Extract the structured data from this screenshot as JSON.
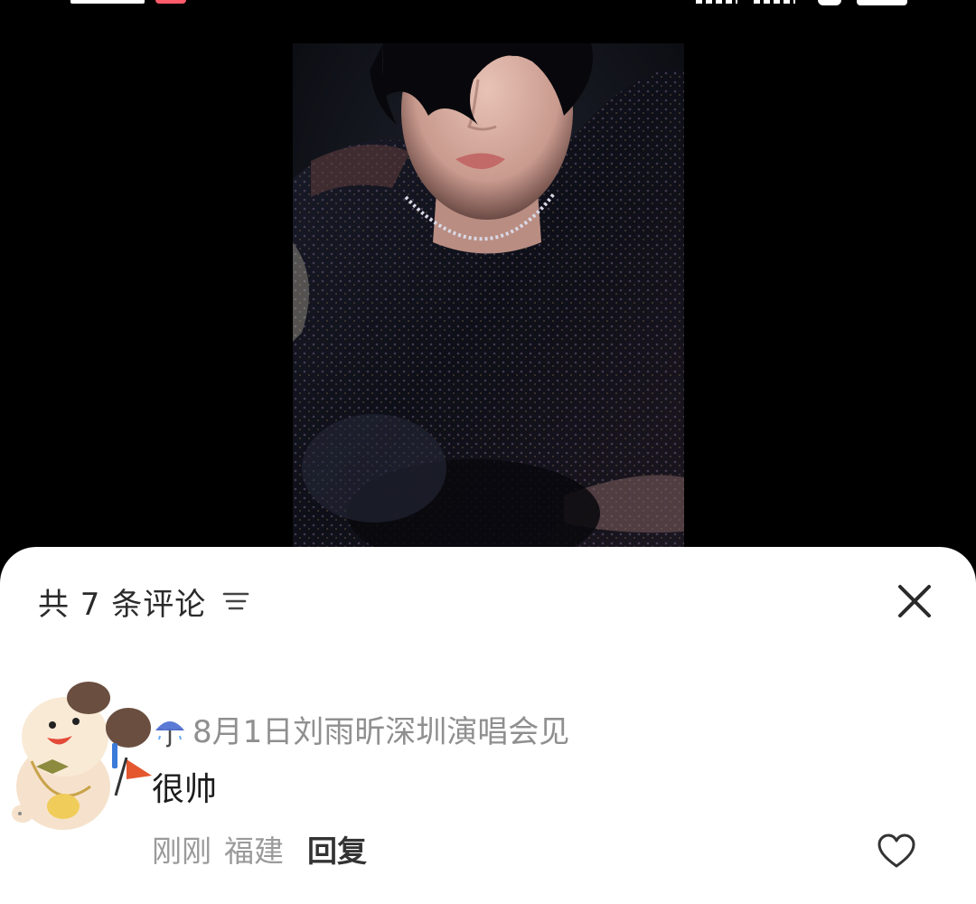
{
  "status_bar": {
    "icons": [
      "time",
      "notification-badge",
      "signal",
      "signal",
      "wifi",
      "battery"
    ]
  },
  "media": {
    "description_icon": "video-frame"
  },
  "comments_sheet": {
    "title": "共 7 条评论",
    "sort_icon": "sort-lines-icon",
    "close_icon": "close-icon",
    "comments": [
      {
        "avatar_icon": "cartoon-dog-avatar",
        "name_prefix_icon": "umbrella-icon",
        "username": "8月1日刘雨昕深圳演唱会见",
        "text": "很帅",
        "time": "刚刚",
        "location": "福建",
        "reply_label": "回复",
        "like_icon": "heart-outline-icon"
      }
    ]
  },
  "colors": {
    "background": "#000000",
    "sheet": "#ffffff",
    "primary_text": "#1c1c1c",
    "secondary_text": "#8f8f8f",
    "badge": "#ff5b6b"
  }
}
